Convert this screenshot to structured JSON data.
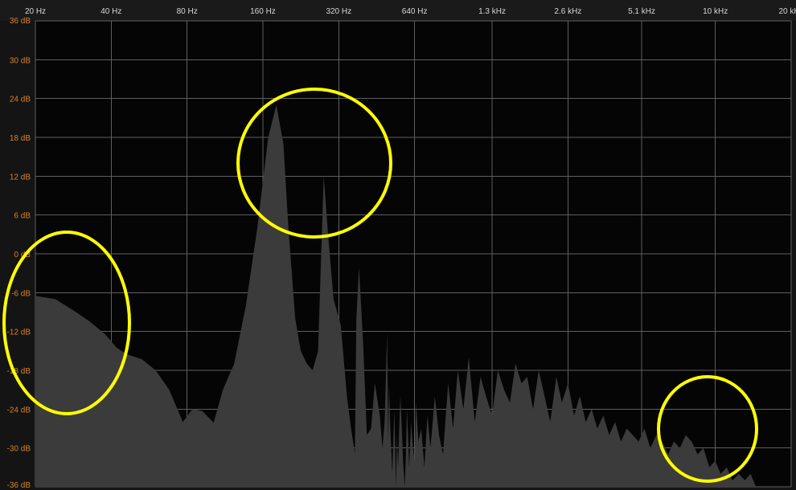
{
  "chart_data": {
    "type": "area",
    "x_scale": "log",
    "x_unit": "Hz",
    "ylim": [
      -36,
      36
    ],
    "grid": true,
    "x_ticks": [
      {
        "hz": 20,
        "label": "20 Hz"
      },
      {
        "hz": 40,
        "label": "40 Hz"
      },
      {
        "hz": 80,
        "label": "80 Hz"
      },
      {
        "hz": 160,
        "label": "160 Hz"
      },
      {
        "hz": 320,
        "label": "320 Hz"
      },
      {
        "hz": 640,
        "label": "640 Hz"
      },
      {
        "hz": 1300,
        "label": "1.3 kHz"
      },
      {
        "hz": 2600,
        "label": "2.6 kHz"
      },
      {
        "hz": 5100,
        "label": "5.1 kHz"
      },
      {
        "hz": 10000,
        "label": "10 kHz"
      },
      {
        "hz": 20000,
        "label": "20 kHz"
      }
    ],
    "y_ticks": [
      {
        "db": 36,
        "label": "36 dB"
      },
      {
        "db": 30,
        "label": "30 dB"
      },
      {
        "db": 24,
        "label": "24 dB"
      },
      {
        "db": 18,
        "label": "18 dB"
      },
      {
        "db": 12,
        "label": "12 dB"
      },
      {
        "db": 6,
        "label": "6 dB"
      },
      {
        "db": 0,
        "label": "0 dB"
      },
      {
        "db": -6,
        "label": "-6 dB"
      },
      {
        "db": -12,
        "label": "-12 dB"
      },
      {
        "db": -18,
        "label": "-18 dB"
      },
      {
        "db": -24,
        "label": "-24 dB"
      },
      {
        "db": -30,
        "label": "-30 dB"
      },
      {
        "db": -36,
        "label": "-36 dB"
      }
    ],
    "spectrum": {
      "x": [
        20,
        24,
        29,
        33,
        38,
        42,
        46,
        53,
        60,
        68,
        77,
        84,
        92,
        102,
        111,
        123,
        137,
        152,
        168,
        181,
        193,
        202,
        215,
        226,
        239,
        252,
        265,
        279,
        289,
        305,
        326,
        345,
        358,
        371,
        376,
        385,
        400,
        414,
        430,
        445,
        466,
        477,
        487,
        498,
        503,
        507,
        510,
        514,
        522,
        526,
        532,
        540,
        545,
        551,
        556,
        562,
        568,
        576,
        585,
        591,
        597,
        603,
        609,
        620,
        630,
        640,
        648,
        663,
        680,
        700,
        720,
        740,
        770,
        800,
        830,
        870,
        910,
        950,
        1000,
        1050,
        1110,
        1170,
        1230,
        1300,
        1370,
        1450,
        1530,
        1610,
        1700,
        1790,
        1890,
        1990,
        2100,
        2210,
        2340,
        2460,
        2600,
        2750,
        2900,
        3060,
        3230,
        3400,
        3590,
        3790,
        4000,
        4220,
        4450,
        4700,
        4960,
        5230,
        5520,
        5830,
        6150,
        6490,
        6850,
        7230,
        7630,
        8050,
        8500,
        8970,
        9470,
        9990,
        10500,
        11100,
        11700,
        12400,
        13100,
        13800,
        14500
      ],
      "db": [
        -6.5,
        -7.0,
        -9.0,
        -10.5,
        -12.5,
        -14.5,
        -15.5,
        -16.3,
        -18,
        -21,
        -26,
        -24,
        -24.3,
        -26.1,
        -21,
        -17,
        -8,
        4,
        18,
        23,
        17,
        4,
        -10,
        -15,
        -17,
        -18,
        -15,
        12,
        4,
        -7,
        -11,
        -22,
        -27,
        -30.8,
        -10,
        -2,
        -14,
        -28,
        -27,
        -20,
        -25,
        -30,
        -26,
        -12,
        -29,
        -20,
        -24,
        -28,
        -34,
        -30,
        -24,
        -36,
        -28,
        -33,
        -27,
        -22,
        -26,
        -32,
        -36,
        -31,
        -24,
        -28,
        -33,
        -26,
        -30,
        -32,
        -23,
        -29,
        -27,
        -33,
        -25,
        -30,
        -22,
        -28,
        -31,
        -20,
        -27,
        -18,
        -24,
        -16,
        -26,
        -19,
        -22,
        -25,
        -18,
        -21,
        -23,
        -17,
        -20,
        -19,
        -24,
        -18,
        -22,
        -26,
        -19,
        -23,
        -20,
        -25,
        -22,
        -26,
        -24,
        -27,
        -25,
        -28,
        -26,
        -29,
        -27,
        -28,
        -29,
        -27,
        -30,
        -28,
        -29,
        -31,
        -29,
        -30,
        -28,
        -29,
        -31,
        -30,
        -33,
        -32,
        -34,
        -33,
        -35,
        -34,
        -35,
        -34,
        -36
      ]
    }
  }
}
